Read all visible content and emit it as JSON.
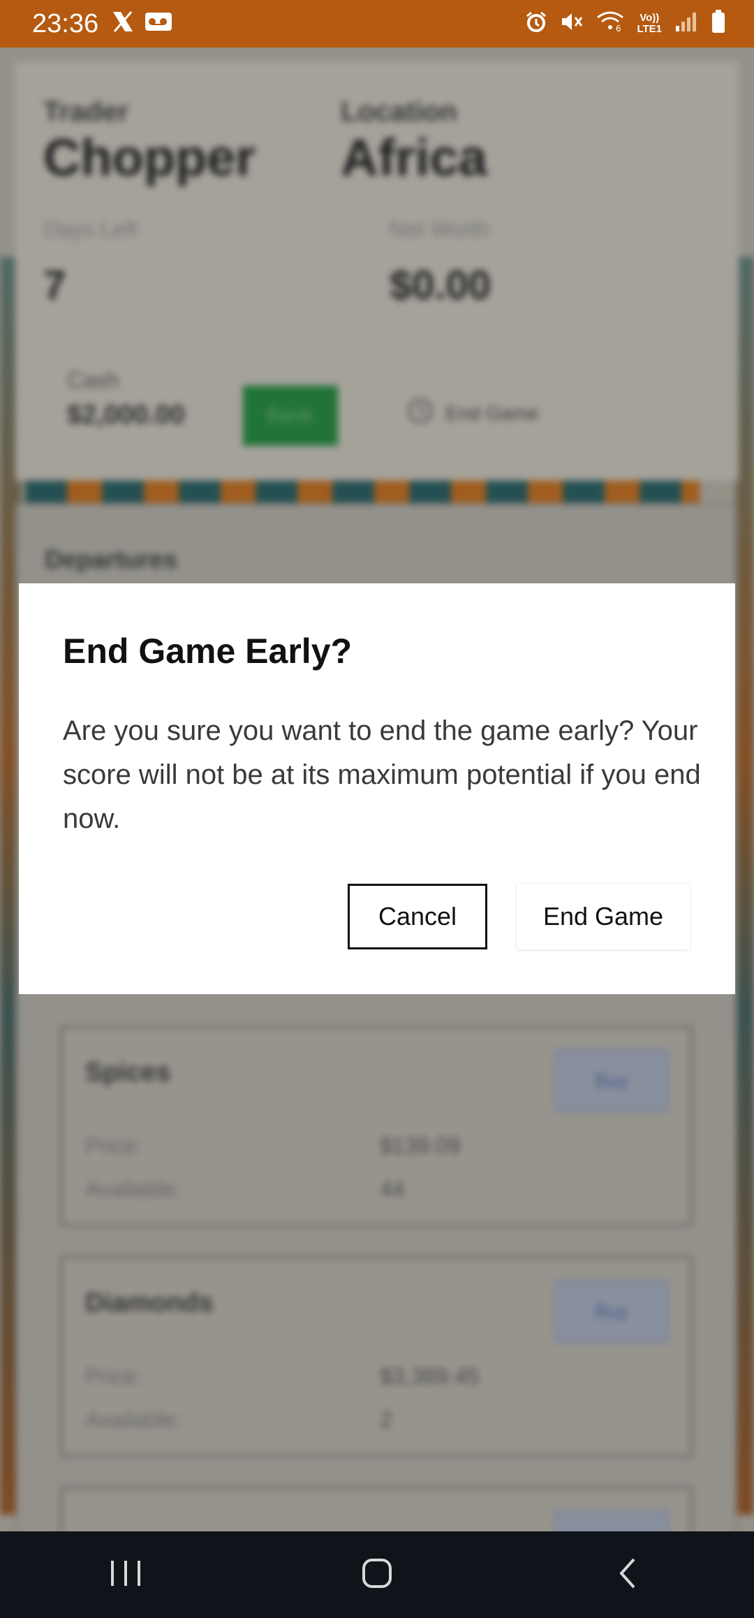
{
  "status_bar": {
    "time": "23:36",
    "left_icons": [
      "x-icon",
      "voicemail-icon"
    ],
    "right_icons": [
      "alarm-icon",
      "mute-icon",
      "wifi-icon",
      "volte-icon",
      "signal-icon",
      "battery-icon"
    ],
    "volte_text": "Vo)) LTE1",
    "wifi_badge": "6"
  },
  "header": {
    "trader_label": "Trader",
    "trader_name": "Chopper",
    "location_label": "Location",
    "location_name": "Africa",
    "days_left_label": "Days Left",
    "days_left_value": "7",
    "net_worth_label": "Net Worth",
    "net_worth_value": "$0.00",
    "cash_label": "Cash",
    "cash_value": "$2,000.00",
    "bank_button": "Bank",
    "end_game_link": "End Game"
  },
  "departures": {
    "title": "Departures"
  },
  "inventory": [
    {
      "name": "Spices",
      "buy_label": "Buy",
      "price_label": "Price:",
      "price": "$139.09",
      "available_label": "Available:",
      "available": "44"
    },
    {
      "name": "Diamonds",
      "buy_label": "Buy",
      "price_label": "Price:",
      "price": "$3,389.45",
      "available_label": "Available:",
      "available": "2"
    }
  ],
  "dialog": {
    "title": "End Game Early?",
    "body": "Are you sure you want to end the game early? Your score will not be at its maximum potential if you end now.",
    "cancel_label": "Cancel",
    "confirm_label": "End Game"
  },
  "colors": {
    "status_bar": "#b55a10",
    "bank_button": "#1f8d3e",
    "nav_bar": "#0f141a",
    "dialog_bg": "#ffffff"
  }
}
